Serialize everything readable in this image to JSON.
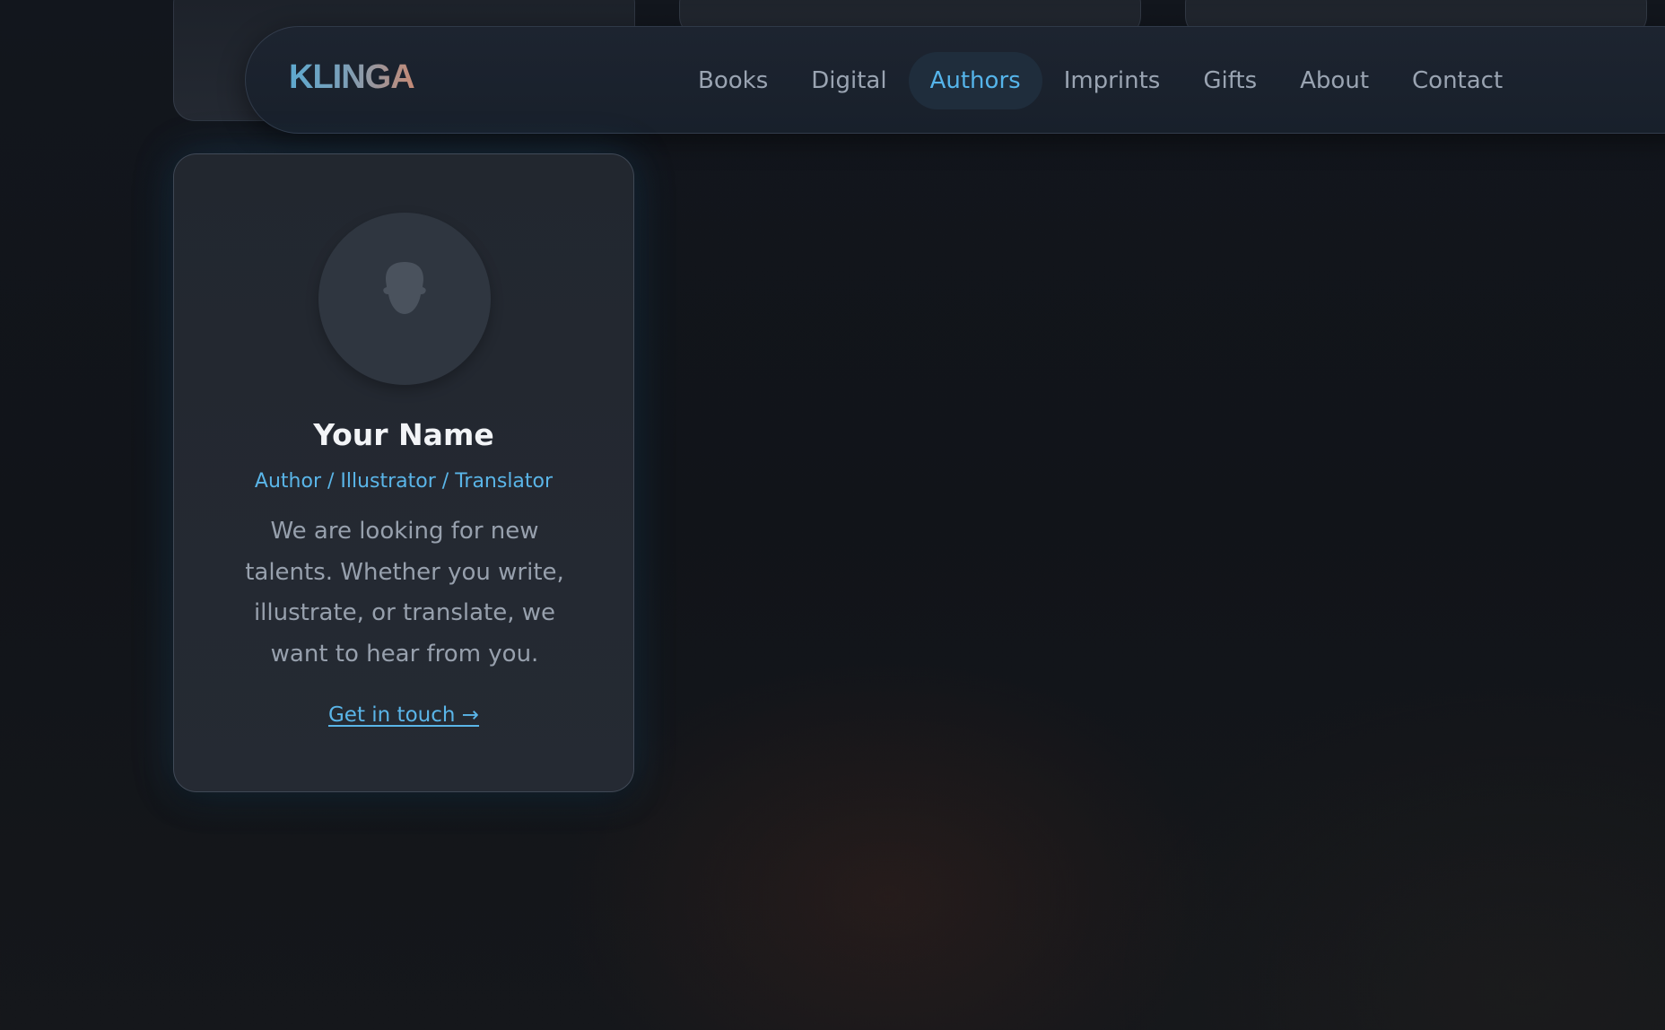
{
  "brand": {
    "logo_text": "KLINGA"
  },
  "nav": {
    "items": [
      {
        "label": "Books"
      },
      {
        "label": "Digital"
      },
      {
        "label": "Authors",
        "active": true
      },
      {
        "label": "Imprints"
      },
      {
        "label": "Gifts"
      },
      {
        "label": "About"
      },
      {
        "label": "Contact"
      }
    ]
  },
  "author_card": {
    "name": "Your Name",
    "role": "Author / Illustrator / Translator",
    "description": "We are looking for new talents. Whether you write, illustrate, or translate, we want to hear from you.",
    "cta_label": "Get in touch →",
    "avatar_icon": "person-silhouette-icon"
  },
  "colors": {
    "accent": "#55b4ea",
    "background": "#111419",
    "card": "#252a33",
    "nav_active_bg": "#1f2d3c"
  }
}
